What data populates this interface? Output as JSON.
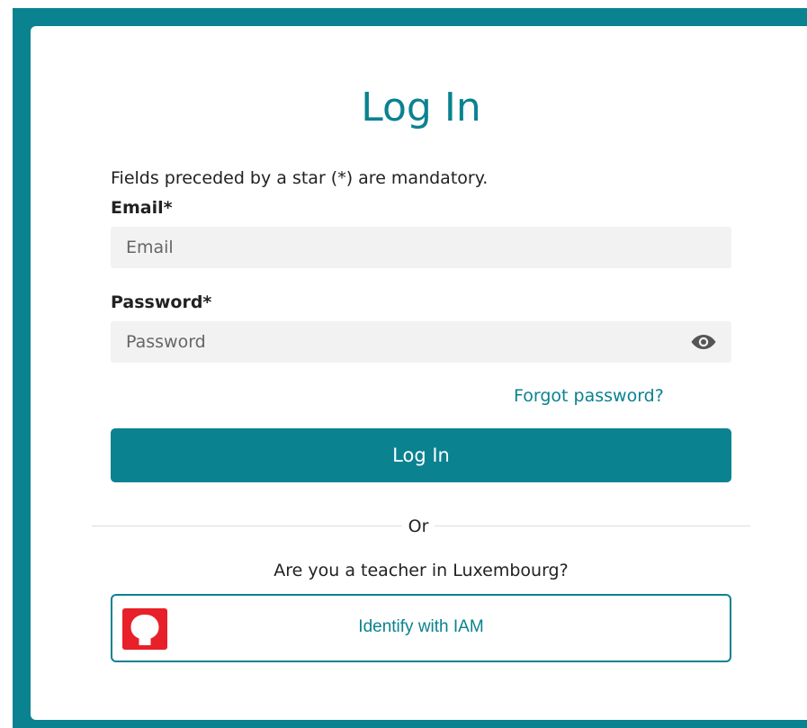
{
  "page": {
    "title": "Log In",
    "mandatory_note": "Fields preceded by a star (*) are mandatory."
  },
  "email": {
    "label": "Email*",
    "placeholder": "Email",
    "value": ""
  },
  "password": {
    "label": "Password*",
    "placeholder": "Password",
    "value": "",
    "toggle_icon": "eye-icon"
  },
  "links": {
    "forgot_password": "Forgot password?"
  },
  "buttons": {
    "login_label": "Log In"
  },
  "divider": {
    "text": "Or"
  },
  "teacher": {
    "question": "Are you a teacher in Luxembourg?",
    "iam_label": "Identify with IAM",
    "iam_icon": "iam-logo-icon"
  },
  "colors": {
    "accent": "#0a8290",
    "iam_red": "#e8202a",
    "input_bg": "#f2f2f2"
  }
}
